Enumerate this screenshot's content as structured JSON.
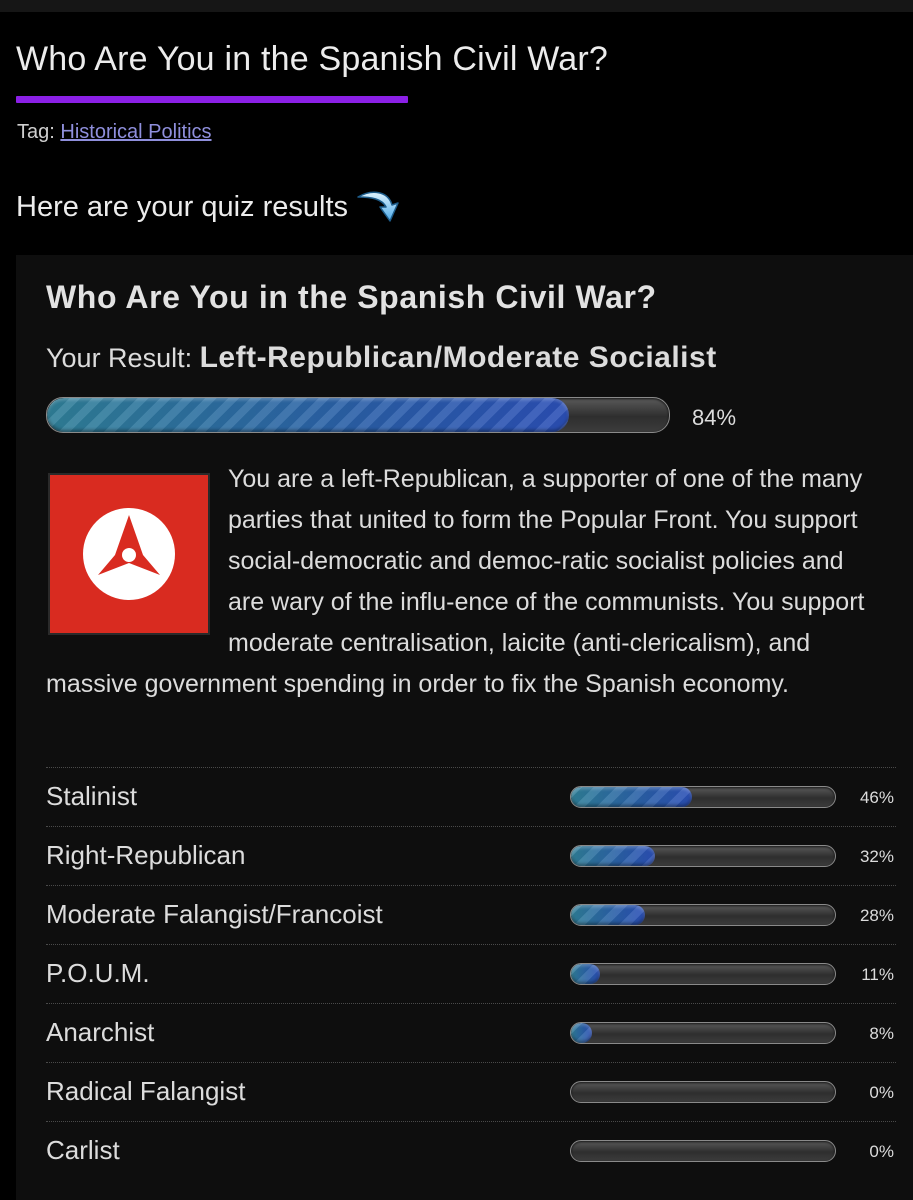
{
  "page": {
    "title": "Who Are You in the Spanish Civil War?",
    "tag_label": "Tag:",
    "tag_link": "Historical Politics",
    "results_intro": "Here are your quiz results"
  },
  "result_card": {
    "title": "Who Are You in the Spanish Civil War?",
    "result_prefix": "Your Result:",
    "result_name": "Left-Republican/Moderate Socialist",
    "result_percent": 84,
    "result_percent_label": "84%",
    "description": "You are a left-Republican, a supporter of one of the many parties that united to form the Popular Front. You support social-democratic and democ-ratic socialist policies and are wary of the influ-ence of the communists. You support moderate centralisation, laicite (anti-clericalism), and massive government spending in order to fix the Spanish economy.",
    "emblem_icon": "three-arrows-circle-emblem"
  },
  "other_results": [
    {
      "label": "Stalinist",
      "percent": 46,
      "percent_label": "46%"
    },
    {
      "label": "Right-Republican",
      "percent": 32,
      "percent_label": "32%"
    },
    {
      "label": "Moderate Falangist/Francoist",
      "percent": 28,
      "percent_label": "28%"
    },
    {
      "label": "P.O.U.M.",
      "percent": 11,
      "percent_label": "11%"
    },
    {
      "label": "Anarchist",
      "percent": 8,
      "percent_label": "8%"
    },
    {
      "label": "Radical Falangist",
      "percent": 0,
      "percent_label": "0%"
    },
    {
      "label": "Carlist",
      "percent": 0,
      "percent_label": "0%"
    }
  ],
  "colors": {
    "accent_underline": "#8b20e6",
    "link": "#8f8fdc",
    "emblem_red": "#d92b20",
    "bar_fill": "#2a5fa8"
  }
}
